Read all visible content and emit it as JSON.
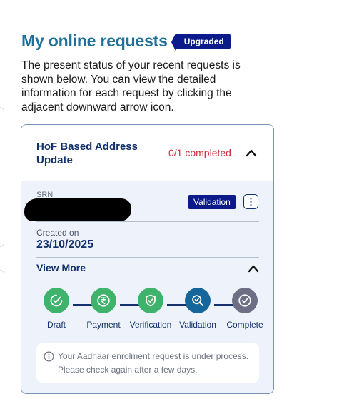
{
  "page": {
    "title": "My online requests",
    "badge": "Upgraded",
    "intro": "The present status of your recent requests is shown below. You can view the detailed information for each request by clicking the adjacent downward arrow icon."
  },
  "request": {
    "title": "HoF Based Address Update",
    "status": "0/1 completed",
    "srn_label": "SRN",
    "stage_badge": "Validation",
    "kebab": "⋮",
    "created_label": "Created on",
    "created_date": "23/10/2025",
    "view_more": "View More",
    "steps": [
      {
        "label": "Draft",
        "state": "done",
        "icon": "check-icon",
        "color": "#3fb36b"
      },
      {
        "label": "Payment",
        "state": "done",
        "icon": "rupee-icon",
        "color": "#3fb36b"
      },
      {
        "label": "Verification",
        "state": "done",
        "icon": "shield-check-icon",
        "color": "#3fb36b"
      },
      {
        "label": "Validation",
        "state": "current",
        "icon": "search-check-icon",
        "color": "#15669a"
      },
      {
        "label": "Complete",
        "state": "pending",
        "icon": "check-circle-icon",
        "color": "#6e6e84"
      }
    ],
    "notice": "Your Aadhaar enrolment request is under process. Please check again after a few days."
  },
  "colors": {
    "title": "#1f6f9a",
    "navy": "#12306b",
    "badge": "#0a1a8a",
    "status_red": "#d02f3a",
    "body_bg": "#eef3fb",
    "done": "#3fb36b",
    "current": "#15669a",
    "pending": "#6e6e84"
  }
}
